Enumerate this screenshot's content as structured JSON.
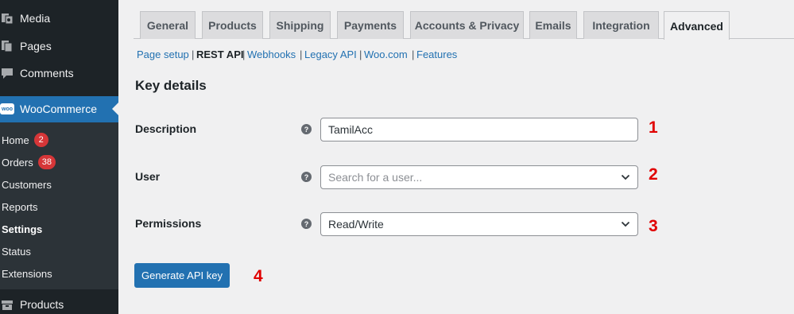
{
  "sidebar": {
    "top_items": [
      {
        "label": "Media",
        "icon": "media-icon"
      },
      {
        "label": "Pages",
        "icon": "pages-icon"
      },
      {
        "label": "Comments",
        "icon": "comments-icon"
      }
    ],
    "woocommerce": {
      "label": "WooCommerce",
      "icon_text": "woo"
    },
    "submenu": [
      {
        "label": "Home",
        "count": "2"
      },
      {
        "label": "Orders",
        "count": "38"
      },
      {
        "label": "Customers"
      },
      {
        "label": "Reports"
      },
      {
        "label": "Settings",
        "current": true
      },
      {
        "label": "Status"
      },
      {
        "label": "Extensions"
      }
    ],
    "products": {
      "label": "Products",
      "icon": "products-icon"
    }
  },
  "tabs": [
    {
      "label": "General"
    },
    {
      "label": "Products"
    },
    {
      "label": "Shipping"
    },
    {
      "label": "Payments"
    },
    {
      "label": "Accounts & Privacy"
    },
    {
      "label": "Emails"
    },
    {
      "label": "Integration"
    },
    {
      "label": "Advanced",
      "active": true
    }
  ],
  "subsections": [
    {
      "label": "Page setup"
    },
    {
      "label": "REST API",
      "current": true
    },
    {
      "label": "Webhooks"
    },
    {
      "label": "Legacy API"
    },
    {
      "label": "Woo.com"
    },
    {
      "label": "Features"
    }
  ],
  "subsection_separator": "|",
  "form": {
    "title": "Key details",
    "help_glyph": "?",
    "description": {
      "label": "Description",
      "value": "TamilAcc",
      "marker": "1"
    },
    "user": {
      "label": "User",
      "placeholder": "Search for a user...",
      "marker": "2"
    },
    "permissions": {
      "label": "Permissions",
      "value": "Read/Write",
      "marker": "3"
    },
    "generate_button": {
      "label": "Generate API key",
      "marker": "4"
    }
  },
  "colors": {
    "accent": "#2271b1",
    "sidebar_bg": "#1d2327",
    "submenu_bg": "#2c3338",
    "badge": "#d63638",
    "marker": "#e00000"
  }
}
